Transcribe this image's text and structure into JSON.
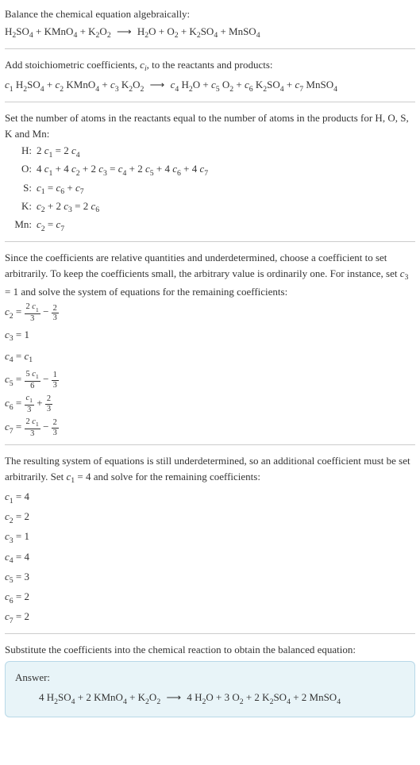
{
  "intro": {
    "line1": "Balance the chemical equation algebraically:",
    "eq_lhs_1": "H",
    "eq_lhs_1s": "2",
    "eq_lhs_2": "SO",
    "eq_lhs_2s": "4",
    "eq_lhs_3": " + KMnO",
    "eq_lhs_3s": "4",
    "eq_lhs_4": " + K",
    "eq_lhs_4s": "2",
    "eq_lhs_5": "O",
    "eq_lhs_5s": "2",
    "arrow": " ⟶ ",
    "eq_rhs_1": "H",
    "eq_rhs_1s": "2",
    "eq_rhs_2": "O + O",
    "eq_rhs_2s": "2",
    "eq_rhs_3": " + K",
    "eq_rhs_3s": "2",
    "eq_rhs_4": "SO",
    "eq_rhs_4s": "4",
    "eq_rhs_5": " + MnSO",
    "eq_rhs_5s": "4"
  },
  "stoich": {
    "line1a": "Add stoichiometric coefficients, ",
    "line1b": "c",
    "line1c": "i",
    "line1d": ", to the reactants and products:",
    "c1": "c",
    "c1s": "1",
    "sp1": " H",
    "sp1a": "2",
    "sp1b": "SO",
    "sp1c": "4",
    "plus1": " + ",
    "c2": "c",
    "c2s": "2",
    "sp2": " KMnO",
    "sp2a": "4",
    "plus2": " + ",
    "c3": "c",
    "c3s": "3",
    "sp3": " K",
    "sp3a": "2",
    "sp3b": "O",
    "sp3c": "2",
    "arrow": " ⟶ ",
    "c4": "c",
    "c4s": "4",
    "sp4": " H",
    "sp4a": "2",
    "sp4b": "O",
    "plus3": " + ",
    "c5": "c",
    "c5s": "5",
    "sp5": " O",
    "sp5a": "2",
    "plus4": " + ",
    "c6": "c",
    "c6s": "6",
    "sp6": " K",
    "sp6a": "2",
    "sp6b": "SO",
    "sp6c": "4",
    "plus5": " + ",
    "c7": "c",
    "c7s": "7",
    "sp7": " MnSO",
    "sp7a": "4"
  },
  "atoms": {
    "intro": "Set the number of atoms in the reactants equal to the number of atoms in the products for H, O, S, K and Mn:",
    "rows": [
      {
        "label": "H:",
        "t1": "2 ",
        "c1": "c",
        "c1s": "1",
        "t2": " = 2 ",
        "c2": "c",
        "c2s": "4"
      },
      {
        "label": "O:",
        "t1": "4 ",
        "c1": "c",
        "c1s": "1",
        "t2": " + 4 ",
        "c2": "c",
        "c2s": "2",
        "t3": " + 2 ",
        "c3": "c",
        "c3s": "3",
        "t4": " = ",
        "c4": "c",
        "c4s": "4",
        "t5": " + 2 ",
        "c5": "c",
        "c5s": "5",
        "t6": " + 4 ",
        "c6": "c",
        "c6s": "6",
        "t7": " + 4 ",
        "c7": "c",
        "c7s": "7"
      },
      {
        "label": "S:",
        "c1": "c",
        "c1s": "1",
        "t2": " = ",
        "c2": "c",
        "c2s": "6",
        "t3": " + ",
        "c3": "c",
        "c3s": "7"
      },
      {
        "label": "K:",
        "c1": "c",
        "c1s": "2",
        "t2": " + 2 ",
        "c2": "c",
        "c2s": "3",
        "t3": " = 2 ",
        "c3": "c",
        "c3s": "6"
      },
      {
        "label": "Mn:",
        "c1": "c",
        "c1s": "2",
        "t2": " = ",
        "c2": "c",
        "c2s": "7"
      }
    ]
  },
  "underdet1": {
    "text_a": "Since the coefficients are relative quantities and underdetermined, choose a coefficient to set arbitrarily. To keep the coefficients small, the arbitrary value is ordinarily one. For instance, set ",
    "text_b": "c",
    "text_c": "3",
    "text_d": " = 1 and solve the system of equations for the remaining coefficients:",
    "c2_l": "c",
    "c2_ls": "2",
    "c2_eq": " = ",
    "c2_f1n_a": "2 ",
    "c2_f1n_b": "c",
    "c2_f1n_c": "1",
    "c2_f1d": "3",
    "c2_mid": " − ",
    "c2_f2n": "2",
    "c2_f2d": "3",
    "c3_l": "c",
    "c3_ls": "3",
    "c3_r": " = 1",
    "c4_l": "c",
    "c4_ls": "4",
    "c4_eq": " = ",
    "c4_r": "c",
    "c4_rs": "1",
    "c5_l": "c",
    "c5_ls": "5",
    "c5_eq": " = ",
    "c5_f1n_a": "5 ",
    "c5_f1n_b": "c",
    "c5_f1n_c": "1",
    "c5_f1d": "6",
    "c5_mid": " − ",
    "c5_f2n": "1",
    "c5_f2d": "3",
    "c6_l": "c",
    "c6_ls": "6",
    "c6_eq": " = ",
    "c6_f1n_b": "c",
    "c6_f1n_c": "1",
    "c6_f1d": "3",
    "c6_mid": " + ",
    "c6_f2n": "2",
    "c6_f2d": "3",
    "c7_l": "c",
    "c7_ls": "7",
    "c7_eq": " = ",
    "c7_f1n_a": "2 ",
    "c7_f1n_b": "c",
    "c7_f1n_c": "1",
    "c7_f1d": "3",
    "c7_mid": " − ",
    "c7_f2n": "2",
    "c7_f2d": "3"
  },
  "underdet2": {
    "text_a": "The resulting system of equations is still underdetermined, so an additional coefficient must be set arbitrarily. Set ",
    "text_b": "c",
    "text_c": "1",
    "text_d": " = 4 and solve for the remaining coefficients:",
    "rows": [
      {
        "l": "c",
        "ls": "1",
        "r": " = 4"
      },
      {
        "l": "c",
        "ls": "2",
        "r": " = 2"
      },
      {
        "l": "c",
        "ls": "3",
        "r": " = 1"
      },
      {
        "l": "c",
        "ls": "4",
        "r": " = 4"
      },
      {
        "l": "c",
        "ls": "5",
        "r": " = 3"
      },
      {
        "l": "c",
        "ls": "6",
        "r": " = 2"
      },
      {
        "l": "c",
        "ls": "7",
        "r": " = 2"
      }
    ]
  },
  "final": {
    "text": "Substitute the coefficients into the chemical reaction to obtain the balanced equation:",
    "answer_label": "Answer:",
    "a1": "4 H",
    "a1s": "2",
    "a2": "SO",
    "a2s": "4",
    "a3": " + 2 KMnO",
    "a3s": "4",
    "a4": " + K",
    "a4s": "2",
    "a5": "O",
    "a5s": "2",
    "arrow": " ⟶ ",
    "b1": "4 H",
    "b1s": "2",
    "b2": "O + 3 O",
    "b2s": "2",
    "b3": " + 2 K",
    "b3s": "2",
    "b4": "SO",
    "b4s": "4",
    "b5": " + 2 MnSO",
    "b5s": "4"
  }
}
